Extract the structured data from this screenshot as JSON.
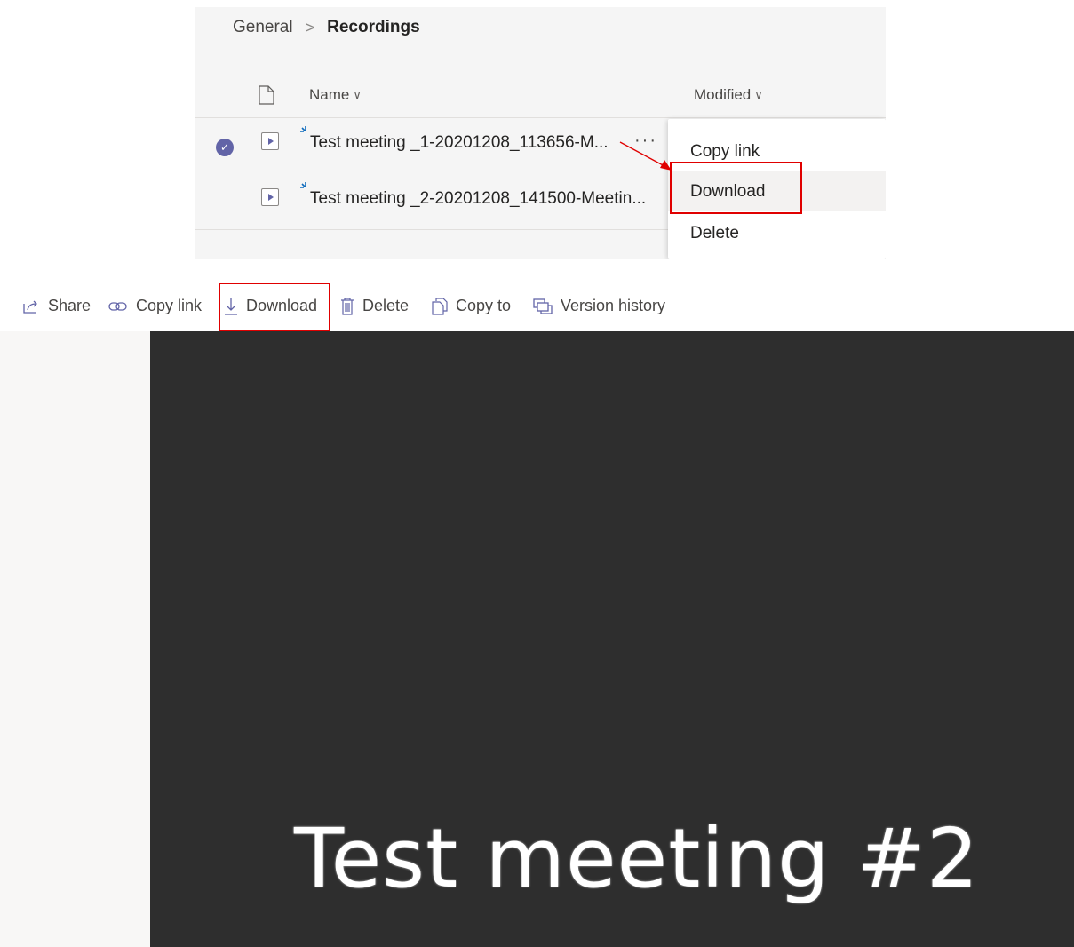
{
  "breadcrumb": {
    "parent": "General",
    "separator": ">",
    "current": "Recordings"
  },
  "list": {
    "columns": {
      "name": "Name",
      "modified": "Modified",
      "sort_glyph": "∨"
    },
    "rows": [
      {
        "name": "Test meeting _1-20201208_113656-M...",
        "selected": true,
        "more": "···"
      },
      {
        "name": "Test meeting _2-20201208_141500-Meetin...",
        "selected": false
      }
    ]
  },
  "context_menu": {
    "items": [
      "Copy link",
      "Download",
      "Delete"
    ]
  },
  "toolbar": {
    "share": "Share",
    "copy_link": "Copy link",
    "download": "Download",
    "delete": "Delete",
    "copy_to": "Copy to",
    "version_history": "Version history"
  },
  "viewer": {
    "title": "Test meeting #2"
  },
  "colors": {
    "accent": "#6264a7",
    "highlight": "#e00000",
    "video_bg": "#2e2e2e"
  }
}
